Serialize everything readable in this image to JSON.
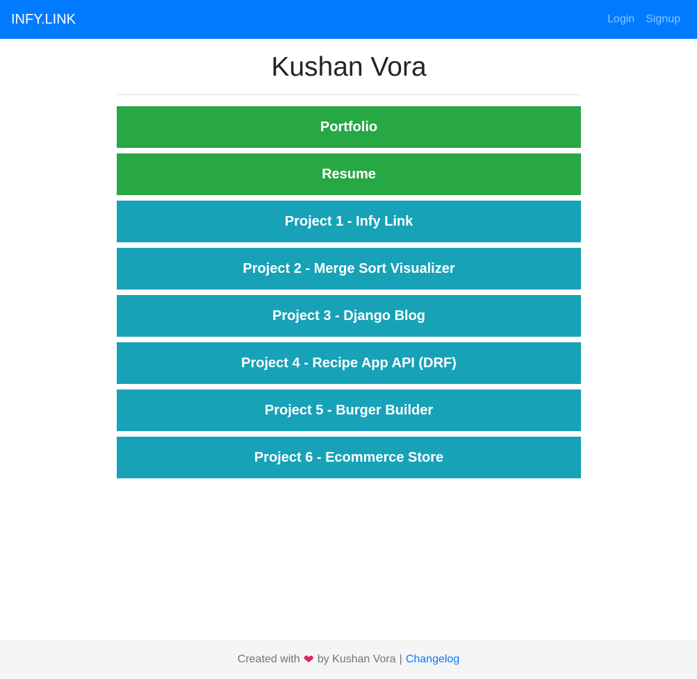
{
  "navbar": {
    "brand": "INFY.LINK",
    "login_label": "Login",
    "signup_label": "Signup"
  },
  "profile": {
    "name": "Kushan Vora"
  },
  "links": [
    {
      "label": "Portfolio",
      "style": "success"
    },
    {
      "label": "Resume",
      "style": "success"
    },
    {
      "label": "Project 1 - Infy Link",
      "style": "info"
    },
    {
      "label": "Project 2 - Merge Sort Visualizer",
      "style": "info"
    },
    {
      "label": "Project 3 - Django Blog",
      "style": "info"
    },
    {
      "label": "Project 4 - Recipe App API (DRF)",
      "style": "info"
    },
    {
      "label": "Project 5 - Burger Builder",
      "style": "info"
    },
    {
      "label": "Project 6 - Ecommerce Store",
      "style": "info"
    }
  ],
  "footer": {
    "created_with": "Created with",
    "heart_icon": "heart-icon",
    "by_text": "by Kushan Vora",
    "separator": "|",
    "changelog_label": "Changelog"
  },
  "colors": {
    "navbar": "#007bff",
    "success": "#28a745",
    "info": "#17a2b8",
    "footer_bg": "#f5f5f5",
    "link": "#007bff"
  }
}
